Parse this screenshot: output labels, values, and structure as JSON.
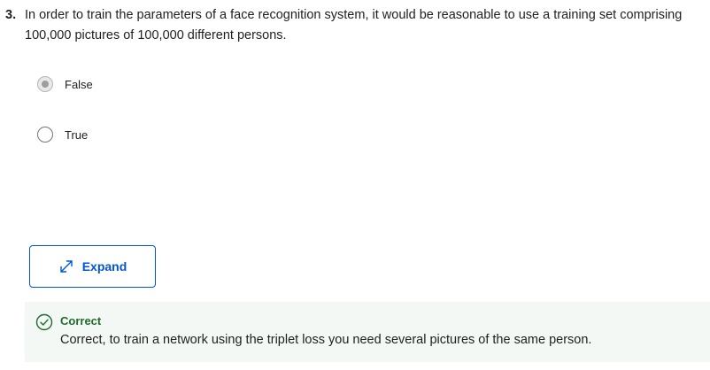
{
  "question": {
    "number": "3.",
    "text": "In order to train the parameters of a face recognition system, it would be reasonable to use a training set comprising 100,000 pictures of 100,000 different persons."
  },
  "options": [
    {
      "label": "False",
      "selected": true
    },
    {
      "label": "True",
      "selected": false
    }
  ],
  "expand_button": {
    "label": "Expand",
    "icon": "expand-arrows-icon"
  },
  "feedback": {
    "status": "Correct",
    "explanation": "Correct, to train a network using the triplet loss you need several pictures of the same person.",
    "icon": "check-circle-icon"
  },
  "colors": {
    "accent": "#0056d2",
    "success": "#1e6b2f",
    "feedback_bg": "#f4f8f4"
  }
}
